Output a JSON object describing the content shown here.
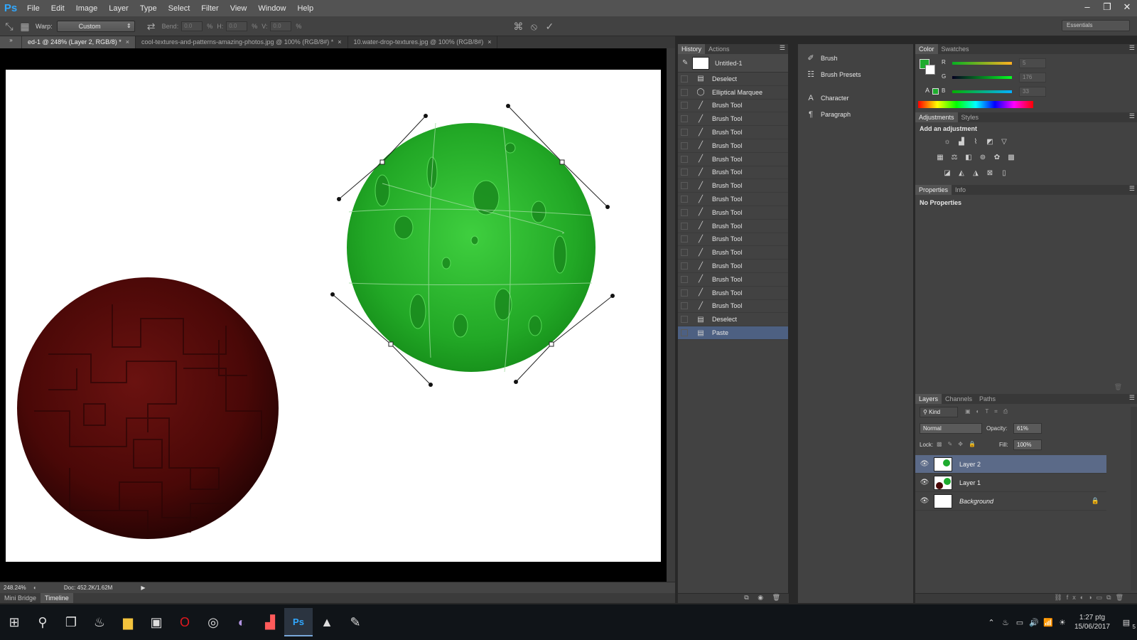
{
  "app": {
    "logo_text": "Ps",
    "menu": [
      "File",
      "Edit",
      "Image",
      "Layer",
      "Type",
      "Select",
      "Filter",
      "View",
      "Window",
      "Help"
    ],
    "window_controls": [
      "–",
      "❐",
      "✕"
    ]
  },
  "options_bar": {
    "warp_label": "Warp:",
    "warp_value": "Custom",
    "bend_label": "Bend:",
    "bend_value": "0.0",
    "h_label": "H:",
    "h_value": "0.0",
    "v_label": "V:",
    "v_value": "0.0",
    "percent": "%",
    "workspace": "Essentials"
  },
  "doc_tabs": [
    {
      "label": "ed-1 @ 248% (Layer 2, RGB/8) *",
      "active": true
    },
    {
      "label": "cool-textures-and-patterns-amazing-photos.jpg @ 100% (RGB/8#) *",
      "active": false
    },
    {
      "label": "10.water-drop-textures.jpg @ 100% (RGB/8#)",
      "active": false
    }
  ],
  "status_bar": {
    "zoom": "248.24%",
    "doc_info": "Doc: 452.2K/1.62M"
  },
  "bottom_tabs": [
    "Mini Bridge",
    "Timeline"
  ],
  "history": {
    "tabs": [
      "History",
      "Actions"
    ],
    "snapshot": "Untitled-1",
    "items": [
      {
        "label": "Deselect",
        "icon": "document-icon"
      },
      {
        "label": "Elliptical Marquee",
        "icon": "ellipse-icon"
      },
      {
        "label": "Brush Tool",
        "icon": "brush-icon"
      },
      {
        "label": "Brush Tool",
        "icon": "brush-icon"
      },
      {
        "label": "Brush Tool",
        "icon": "brush-icon"
      },
      {
        "label": "Brush Tool",
        "icon": "brush-icon"
      },
      {
        "label": "Brush Tool",
        "icon": "brush-icon"
      },
      {
        "label": "Brush Tool",
        "icon": "brush-icon"
      },
      {
        "label": "Brush Tool",
        "icon": "brush-icon"
      },
      {
        "label": "Brush Tool",
        "icon": "brush-icon"
      },
      {
        "label": "Brush Tool",
        "icon": "brush-icon"
      },
      {
        "label": "Brush Tool",
        "icon": "brush-icon"
      },
      {
        "label": "Brush Tool",
        "icon": "brush-icon"
      },
      {
        "label": "Brush Tool",
        "icon": "brush-icon"
      },
      {
        "label": "Brush Tool",
        "icon": "brush-icon"
      },
      {
        "label": "Brush Tool",
        "icon": "brush-icon"
      },
      {
        "label": "Brush Tool",
        "icon": "brush-icon"
      },
      {
        "label": "Brush Tool",
        "icon": "brush-icon"
      },
      {
        "label": "Deselect",
        "icon": "document-icon"
      },
      {
        "label": "Paste",
        "icon": "document-icon",
        "active": true
      }
    ]
  },
  "dock": {
    "group1": [
      "Brush",
      "Brush Presets"
    ],
    "group2": [
      "Character",
      "Paragraph"
    ]
  },
  "color_panel": {
    "tabs": [
      "Color",
      "Swatches"
    ],
    "foreground": "#1eab2e",
    "background": "#ffffff",
    "r_label": "R",
    "g_label": "G",
    "b_label": "B",
    "r_value": "5",
    "g_value": "176",
    "b_value": "33"
  },
  "adjustments": {
    "tabs": [
      "Adjustments",
      "Styles"
    ],
    "title": "Add an adjustment"
  },
  "properties": {
    "tabs": [
      "Properties",
      "Info"
    ],
    "message": "No Properties"
  },
  "layers": {
    "tabs": [
      "Layers",
      "Channels",
      "Paths"
    ],
    "kind_label": "Kind",
    "blend_mode": "Normal",
    "opacity_label": "Opacity:",
    "opacity_value": "61%",
    "lock_label": "Lock:",
    "fill_label": "Fill:",
    "fill_value": "100%",
    "items": [
      {
        "name": "Layer 2",
        "active": true
      },
      {
        "name": "Layer 1",
        "active": false
      },
      {
        "name": "Background",
        "active": false,
        "locked": true
      }
    ]
  },
  "taskbar": {
    "clock_time": "1:27 ptg",
    "clock_date": "15/06/2017",
    "notification_count": "5"
  }
}
